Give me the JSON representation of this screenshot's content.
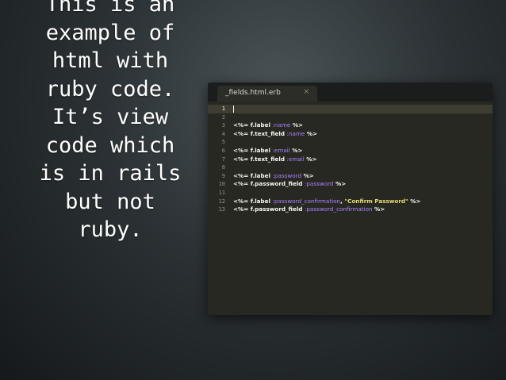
{
  "slide": {
    "text": "This is an\nexample of\nhtml with\nruby code.\nIt’s view\ncode which\nis in rails\nbut not\nruby."
  },
  "editor": {
    "tab": {
      "title": "_fields.html.erb",
      "close_glyph": "×"
    },
    "active_line": 1,
    "line_numbers": [
      "1",
      "2",
      "3",
      "4",
      "5",
      "6",
      "7",
      "8",
      "9",
      "10",
      "11",
      "12",
      "13"
    ],
    "lines": [
      [],
      [],
      [
        {
          "t": "<%= ",
          "c": "tag"
        },
        {
          "t": "f.label ",
          "c": "method"
        },
        {
          "t": ":name",
          "c": "sym"
        },
        {
          "t": " %>",
          "c": "tag"
        }
      ],
      [
        {
          "t": "<%= ",
          "c": "tag"
        },
        {
          "t": "f.text_field ",
          "c": "method"
        },
        {
          "t": ":name",
          "c": "sym"
        },
        {
          "t": " %>",
          "c": "tag"
        }
      ],
      [],
      [
        {
          "t": "<%= ",
          "c": "tag"
        },
        {
          "t": "f.label ",
          "c": "method"
        },
        {
          "t": ":email",
          "c": "sym"
        },
        {
          "t": " %>",
          "c": "tag"
        }
      ],
      [
        {
          "t": "<%= ",
          "c": "tag"
        },
        {
          "t": "f.text_field ",
          "c": "method"
        },
        {
          "t": ":email",
          "c": "sym"
        },
        {
          "t": " %>",
          "c": "tag"
        }
      ],
      [],
      [
        {
          "t": "<%= ",
          "c": "tag"
        },
        {
          "t": "f.label ",
          "c": "method"
        },
        {
          "t": ":password",
          "c": "sym"
        },
        {
          "t": " %>",
          "c": "tag"
        }
      ],
      [
        {
          "t": "<%= ",
          "c": "tag"
        },
        {
          "t": "f.password_field ",
          "c": "method"
        },
        {
          "t": ":password",
          "c": "sym"
        },
        {
          "t": " %>",
          "c": "tag"
        }
      ],
      [],
      [
        {
          "t": "<%= ",
          "c": "tag"
        },
        {
          "t": "f.label ",
          "c": "method"
        },
        {
          "t": ":password_confirmation",
          "c": "sym"
        },
        {
          "t": ", ",
          "c": "punct"
        },
        {
          "t": "\"Confirm Password\"",
          "c": "str"
        },
        {
          "t": " %>",
          "c": "tag"
        }
      ],
      [
        {
          "t": "<%= ",
          "c": "tag"
        },
        {
          "t": "f.password_field ",
          "c": "method"
        },
        {
          "t": ":password_confirmation",
          "c": "sym"
        },
        {
          "t": " %>",
          "c": "tag"
        }
      ]
    ]
  },
  "colors": {
    "code_background": "#272822",
    "symbol": "#ae81ff",
    "string": "#e6db74",
    "default_text": "#f8f8f2",
    "line_number": "#8f908a"
  }
}
